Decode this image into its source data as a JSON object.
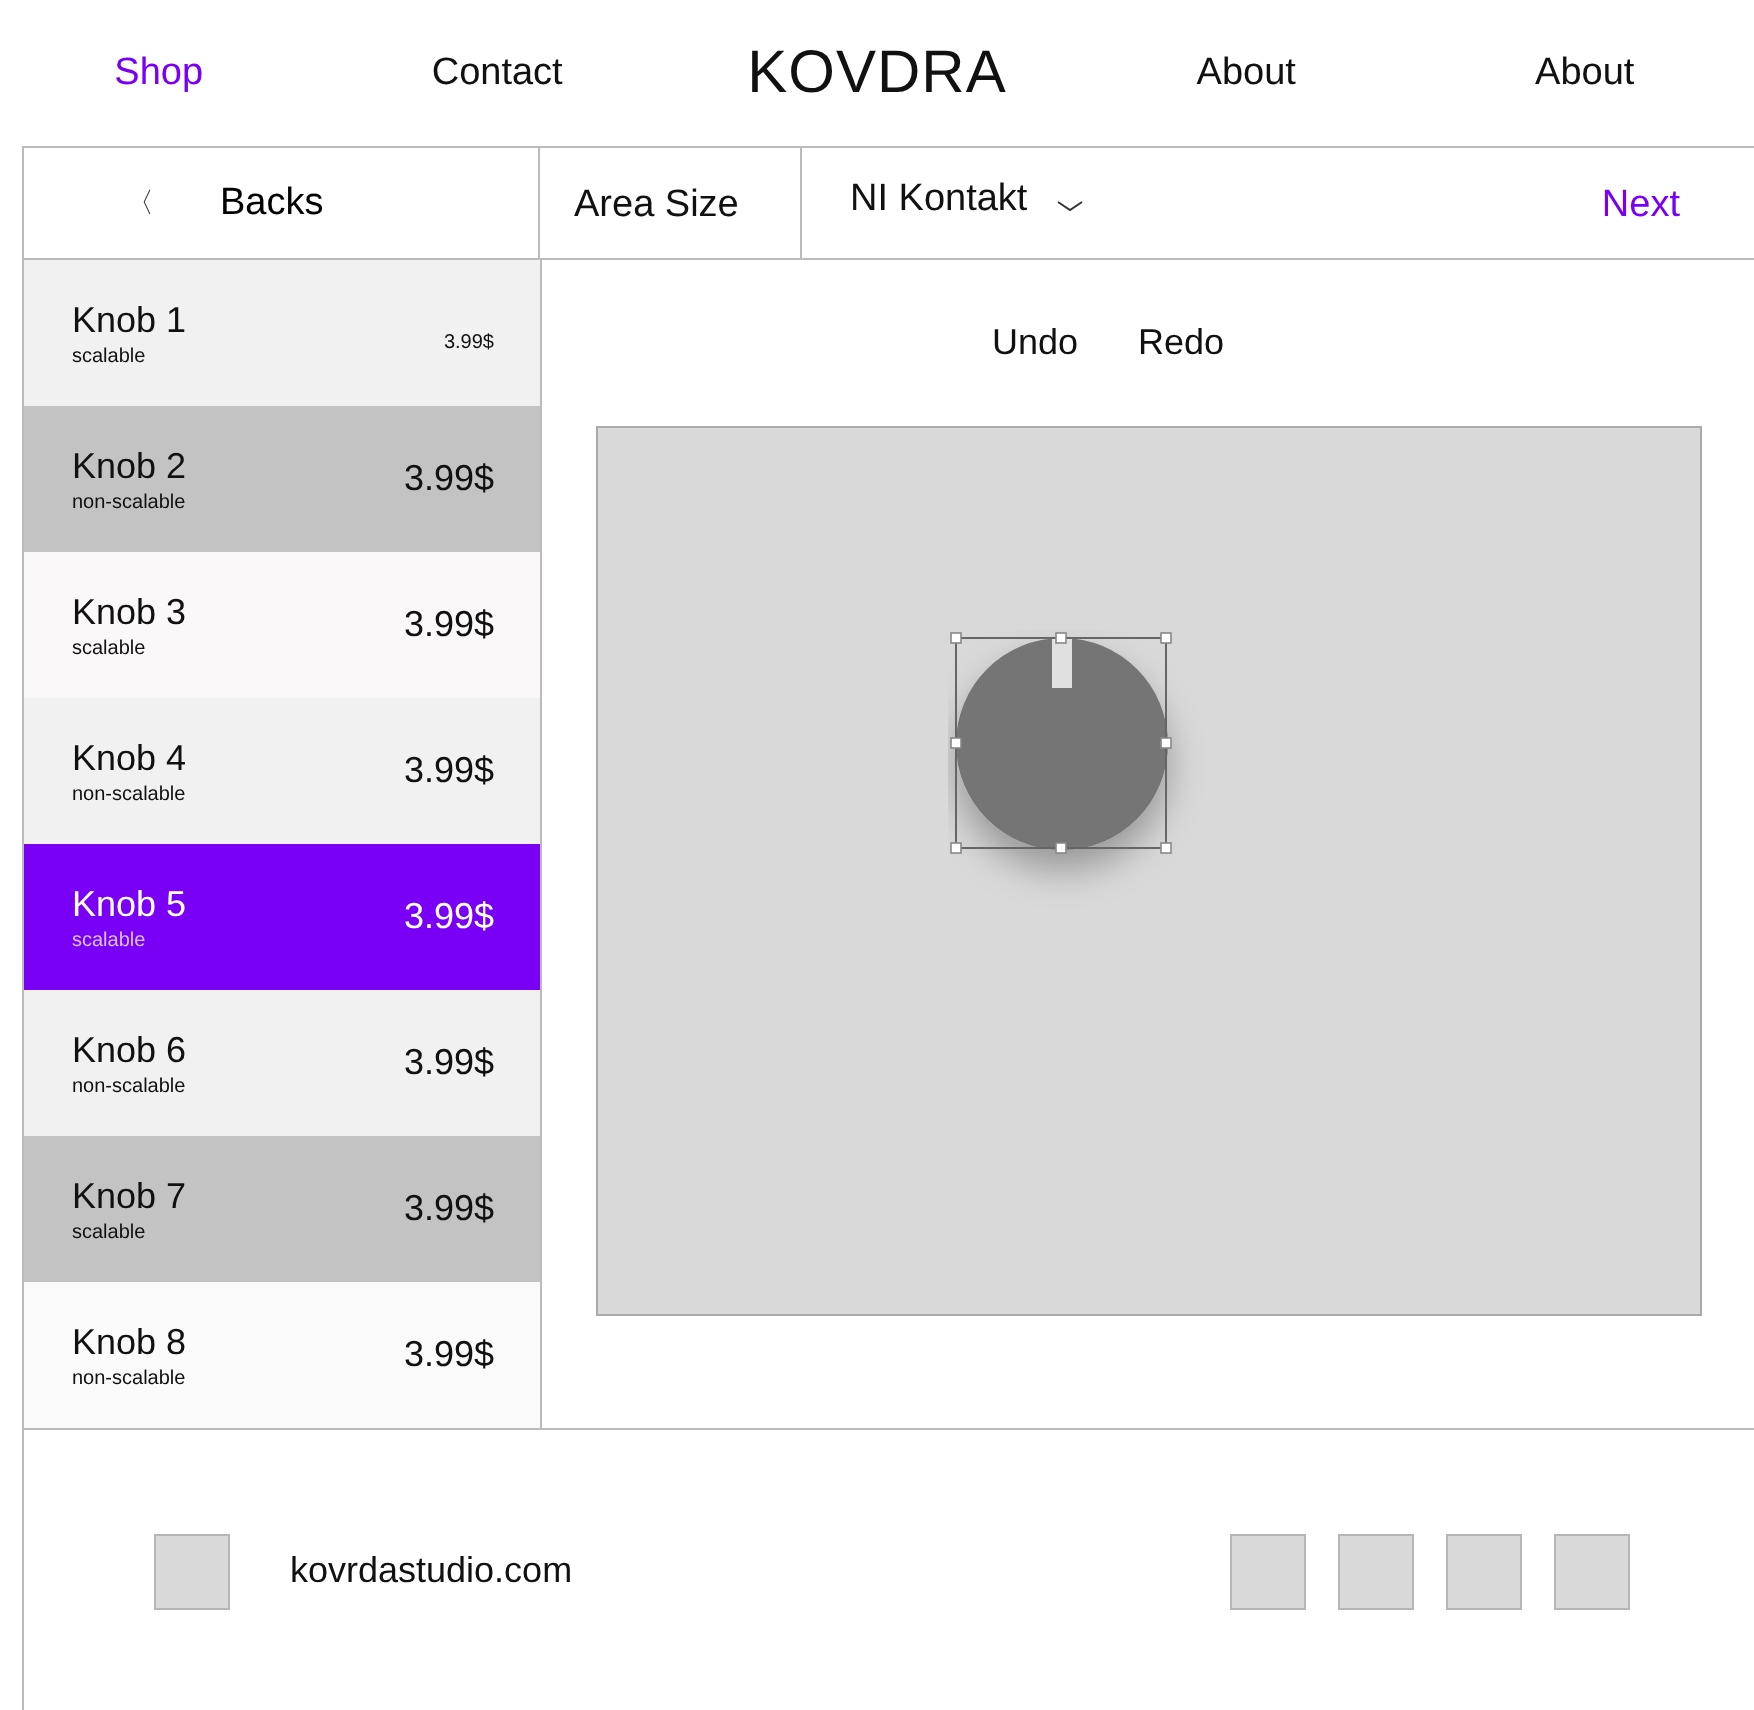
{
  "nav": {
    "left": [
      {
        "label": "Shop",
        "selected": true
      },
      {
        "label": "Contact",
        "selected": false
      }
    ],
    "logo": "KOVDRA",
    "right": [
      {
        "label": "About",
        "selected": false
      },
      {
        "label": "About",
        "selected": false
      }
    ]
  },
  "toolbar": {
    "back_icon": "〈",
    "back_label": "Backs",
    "area_size": "Area Size",
    "plugin": "NI Kontakt",
    "next": "Next"
  },
  "knobs": [
    {
      "name": "Knob 1",
      "type": "scalable",
      "price": "3.99$",
      "kind": "compact",
      "color": "#f1f1f1",
      "selected": false
    },
    {
      "name": "Knob 2",
      "type": "non-scalable",
      "price": "3.99$",
      "kind": "regular",
      "color": "#c3c3c3",
      "selected": false
    },
    {
      "name": "Knob 3",
      "type": "scalable",
      "price": "3.99$",
      "kind": "regular",
      "color": "#faf8f8",
      "selected": false
    },
    {
      "name": "Knob 4",
      "type": "non-scalable",
      "price": "3.99$",
      "kind": "regular",
      "color": "#f1f1f1",
      "selected": false
    },
    {
      "name": "Knob 5",
      "type": "scalable",
      "price": "3.99$",
      "kind": "regular",
      "color": "#7a00f5",
      "selected": true
    },
    {
      "name": "Knob 6",
      "type": "non-scalable",
      "price": "3.99$",
      "kind": "regular",
      "color": "#f1f1f1",
      "selected": false
    },
    {
      "name": "Knob 7",
      "type": "scalable",
      "price": "3.99$",
      "kind": "regular",
      "color": "#c3c3c3",
      "selected": false
    },
    {
      "name": "Knob 8",
      "type": "non-scalable",
      "price": "3.99$",
      "kind": "regular",
      "color": "#fafafa",
      "selected": false
    }
  ],
  "editor": {
    "actions": [
      "Undo",
      "Redo"
    ]
  },
  "footer": {
    "site": "kovrdastudio.com"
  }
}
